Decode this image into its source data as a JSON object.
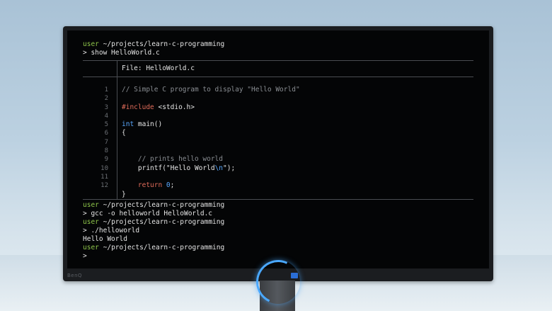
{
  "brand": "BenQ",
  "session_top": {
    "user": "user",
    "path": "~/projects/learn-c-programming",
    "command": "> show HelloWorld.c"
  },
  "viewer": {
    "file_label": "File: HelloWorld.c",
    "line_numbers": [
      "1",
      "2",
      "3",
      "4",
      "5",
      "6",
      "7",
      "8",
      "9",
      "10",
      "11",
      "12"
    ],
    "code": {
      "l1": "// Simple C program to display \"Hello World\"",
      "l3_pre": "#include",
      "l3_rest": " <stdio.h>",
      "l5_kw": "int",
      "l5_rest": " main()",
      "l6": "{",
      "l9": "    // prints hello world",
      "l10_fn": "    printf(\"Hello World",
      "l10_esc": "\\n",
      "l10_end": "\");",
      "l11_kw": "    return",
      "l11_num": " 0",
      "l11_end": ";",
      "l12": "}"
    }
  },
  "session_bottom": {
    "p1_user": "user",
    "p1_path": "~/projects/learn-c-programming",
    "cmd1": "> gcc -o helloworld HelloWorld.c",
    "p2_user": "user",
    "p2_path": "~/projects/learn-c-programming",
    "cmd2": "> ./helloworld",
    "output": "Hello World",
    "p3_user": "user",
    "p3_path": "~/projects/learn-c-programming",
    "prompt": ">"
  },
  "colors": {
    "user": "#8ec54a",
    "keyword": "#5aa9ff",
    "preprocessor": "#e06c5a",
    "comment": "#8a8e93"
  }
}
